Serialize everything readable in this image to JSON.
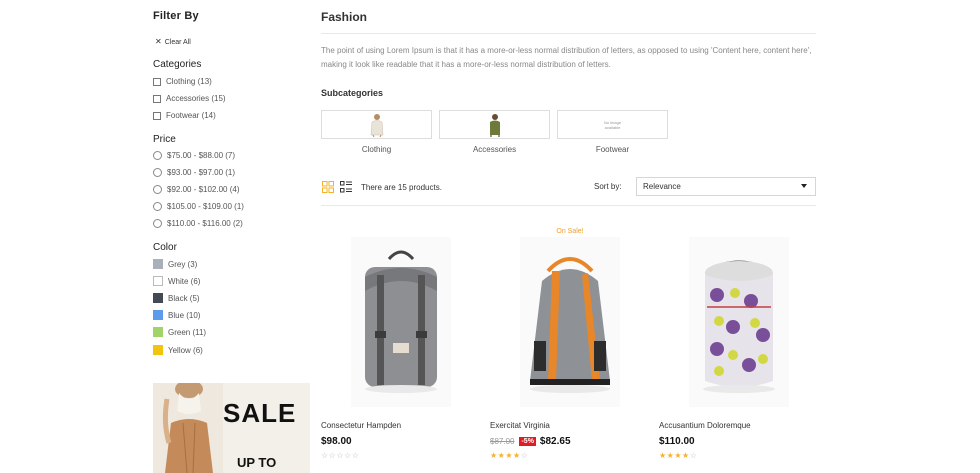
{
  "filters": {
    "title": "Filter By",
    "clear_all": "Clear All",
    "categories": {
      "title": "Categories",
      "items": [
        "Clothing (13)",
        "Accessories (15)",
        "Footwear (14)"
      ]
    },
    "price": {
      "title": "Price",
      "items": [
        "$75.00 - $88.00 (7)",
        "$93.00 - $97.00 (1)",
        "$92.00 - $102.00 (4)",
        "$105.00 - $109.00 (1)",
        "$110.00 - $116.00 (2)"
      ]
    },
    "color": {
      "title": "Color",
      "items": [
        {
          "label": "Grey (3)",
          "swatch": "#aab0bb"
        },
        {
          "label": "White (6)",
          "swatch": "#ffffff"
        },
        {
          "label": "Black (5)",
          "swatch": "#434a54"
        },
        {
          "label": "Blue (10)",
          "swatch": "#5d9cec"
        },
        {
          "label": "Green (11)",
          "swatch": "#a0d468"
        },
        {
          "label": "Yellow (6)",
          "swatch": "#f1c40f"
        }
      ]
    }
  },
  "banner": {
    "sale": "SALE",
    "up_to": "UP TO"
  },
  "category": {
    "title": "Fashion",
    "description": "The point of using Lorem Ipsum is that it has a more-or-less normal distribution of letters, as opposed to using 'Content here, content here', making it look like readable that it has a more-or-less normal distribution of letters.",
    "subcategories_title": "Subcategories",
    "subcategories": [
      {
        "label": "Clothing"
      },
      {
        "label": "Accessories"
      },
      {
        "label": "Footwear",
        "no_image": "No image available"
      }
    ]
  },
  "toolbar": {
    "product_count": "There are 15 products.",
    "sort_by_label": "Sort by:",
    "sort_value": "Relevance",
    "accent": "#f2b22a"
  },
  "products": [
    {
      "name": "Consectetur Hampden",
      "price": "$98.00",
      "old_price": "",
      "discount": "",
      "on_sale": "",
      "rating": 0
    },
    {
      "name": "Exercitat Virginia",
      "price": "$82.65",
      "old_price": "$87.00",
      "discount": "-5%",
      "on_sale": "On Sale!",
      "rating": 4
    },
    {
      "name": "Accusantium Doloremque",
      "price": "$110.00",
      "old_price": "",
      "discount": "",
      "on_sale": "",
      "rating": 4
    }
  ]
}
